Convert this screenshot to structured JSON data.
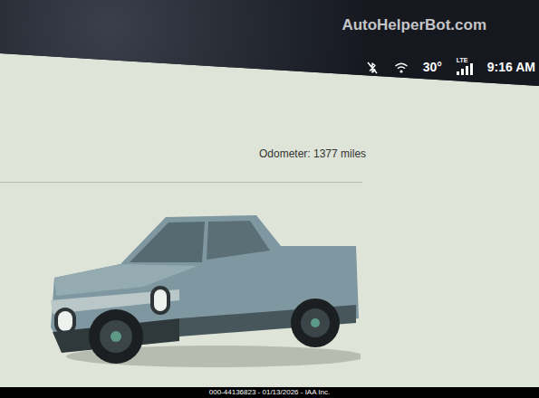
{
  "watermark": "AutoHelperBot.com",
  "status_bar": {
    "bluetooth_connected": false,
    "wifi_connected": true,
    "temperature": "30°",
    "network": "LTE",
    "signal": {
      "level": 1.0
    },
    "time": "9:16 AM"
  },
  "odometer": "Odometer: 1377 miles",
  "footer": "000-44136823 - 01/13/2026 - IAA Inc."
}
